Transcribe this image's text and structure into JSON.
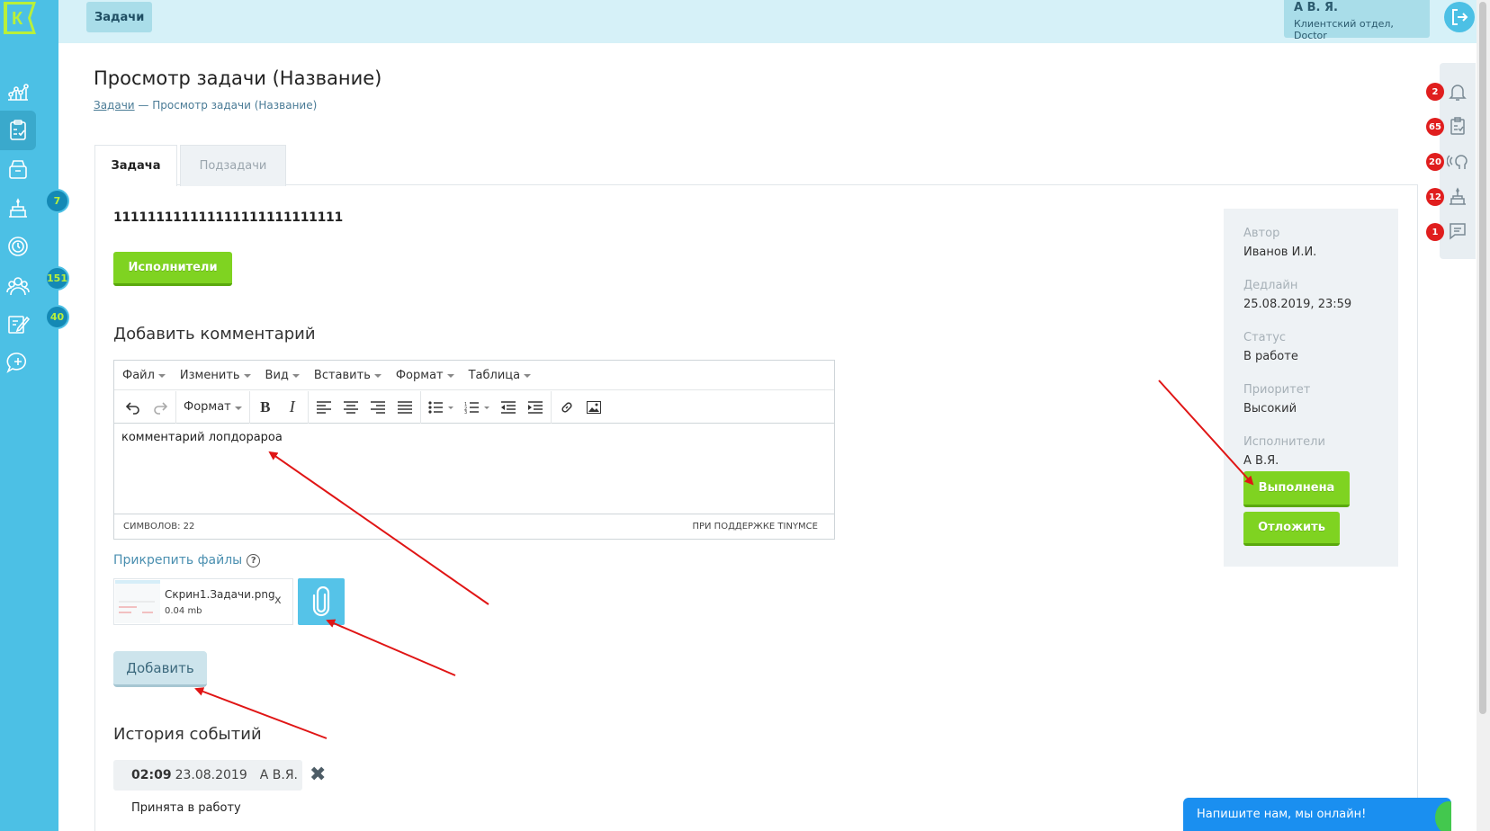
{
  "topbar": {
    "breadcrumb_chip": "Задачи",
    "user_name": "А В. Я.",
    "user_dept": "Клиентский отдел, Doctor"
  },
  "sidebar": {
    "logo_letter": "К",
    "items": [
      {
        "icon": "analytics-icon",
        "badge": ""
      },
      {
        "icon": "tasks-clipboard-icon",
        "badge": "",
        "active": true
      },
      {
        "icon": "archive-box-icon",
        "badge": ""
      },
      {
        "icon": "cake-icon",
        "badge": "7"
      },
      {
        "icon": "money-clock-icon",
        "badge": ""
      },
      {
        "icon": "people-group-icon",
        "badge": "151"
      },
      {
        "icon": "edit-note-icon",
        "badge": "40"
      },
      {
        "icon": "chat-add-icon",
        "badge": ""
      }
    ]
  },
  "rail": {
    "items": [
      {
        "icon": "bell-icon",
        "badge": "2"
      },
      {
        "icon": "clipboard-check-icon",
        "badge": "65"
      },
      {
        "icon": "signal-head-icon",
        "badge": "20"
      },
      {
        "icon": "cake-icon",
        "badge": "12"
      },
      {
        "icon": "message-icon",
        "badge": "1"
      }
    ]
  },
  "page": {
    "title": "Просмотр задачи (Название)",
    "crumb_link": "Задачи",
    "crumb_sep": " — ",
    "crumb_current": "Просмотр задачи (Название)"
  },
  "tabs": [
    {
      "label": "Задача",
      "active": true
    },
    {
      "label": "Подзадачи",
      "active": false
    }
  ],
  "task": {
    "title": "111111111111111111111111111",
    "executors_button": "Исполнители"
  },
  "comment": {
    "heading": "Добавить комментарий",
    "menubar": [
      "Файл",
      "Изменить",
      "Вид",
      "Вставить",
      "Формат",
      "Таблица"
    ],
    "format_dropdown": "Формат",
    "body_text": "комментарий лопдорароа",
    "char_count": "СИМВОЛОВ: 22",
    "powered_by": "ПРИ ПОДДЕРЖКЕ TINYMCE"
  },
  "attach": {
    "label": "Прикрепить файлы",
    "help": "?",
    "file_name": "Скрин1.Задачи.png",
    "file_size": "0.04 mb",
    "remove": "x"
  },
  "add_button": "Добавить",
  "history": {
    "heading": "История событий",
    "time": "02:09",
    "date": "23.08.2019",
    "user": "А В.Я.",
    "close": "✖",
    "text": "Принята в работу"
  },
  "info": {
    "author_label": "Автор",
    "author_value": "Иванов И.И.",
    "deadline_label": "Дедлайн",
    "deadline_value": "25.08.2019, 23:59",
    "status_label": "Статус",
    "status_value": "В работе",
    "priority_label": "Приоритет",
    "priority_value": "Высокий",
    "executors_label": "Исполнители",
    "executors_value": "А В.Я.",
    "done_button": "Выполнена",
    "postpone_button": "Отложить"
  },
  "chat": {
    "text": "Напишите нам, мы онлайн!"
  },
  "colors": {
    "sidebar": "#4cc0e5",
    "topbar": "#d6f1f8",
    "green_button": "#7fd321",
    "badge_red": "#e01e1e",
    "chat": "#1a8ff0",
    "arrow": "#e01515"
  }
}
